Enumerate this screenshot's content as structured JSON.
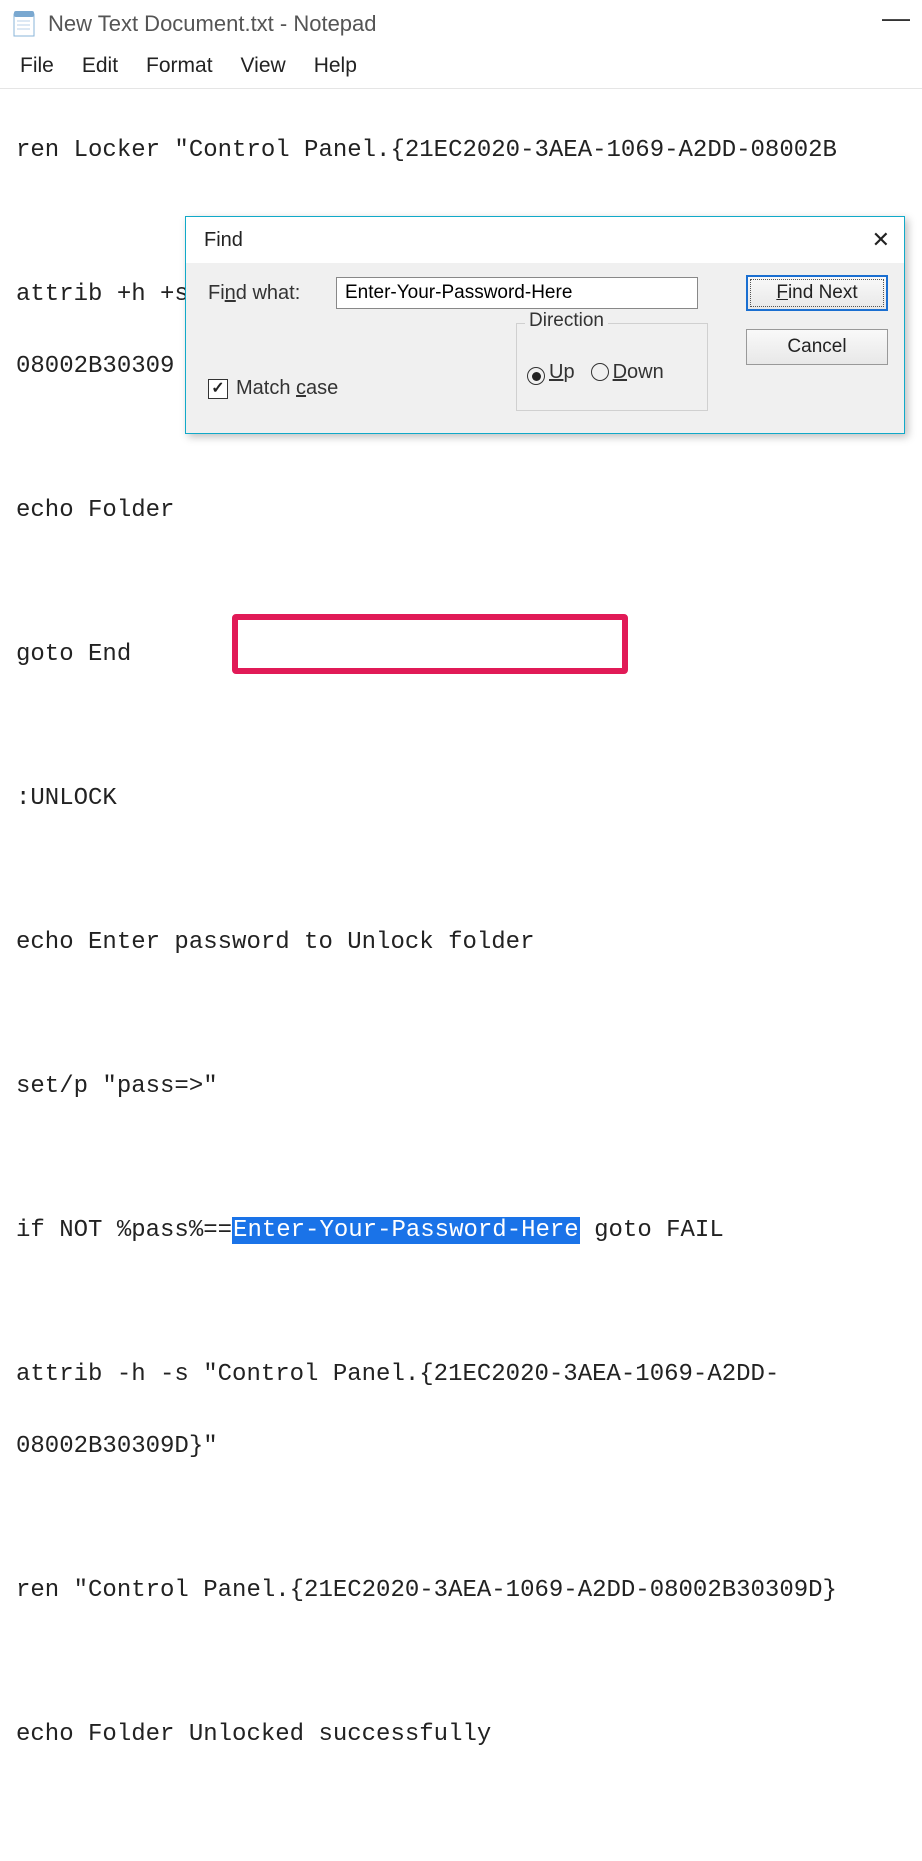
{
  "window": {
    "title": "New Text Document.txt - Notepad"
  },
  "menu": {
    "file": "File",
    "edit": "Edit",
    "format": "Format",
    "view": "View",
    "help": "Help"
  },
  "editor": {
    "l1": "ren Locker \"Control Panel.{21EC2020-3AEA-1069-A2DD-08002B",
    "l2": "attrib +h +s \"Control Panel.{21EC2020-3AEA-1069-A2DD-",
    "l3": "08002B30309",
    "l4": "echo Folder",
    "l5": "goto End",
    "l6": ":UNLOCK",
    "l7": "echo Enter password to Unlock folder",
    "l8": "set/p \"pass=>\"",
    "l9a": "if NOT %pass%==",
    "l9b": "Enter-Your-Password-Here",
    "l9c": " goto FAIL",
    "l10": "attrib -h -s \"Control Panel.{21EC2020-3AEA-1069-A2DD-",
    "l11": "08002B30309D}\"",
    "l12": "ren \"Control Panel.{21EC2020-3AEA-1069-A2DD-08002B30309D}",
    "l13": "echo Folder Unlocked successfully"
  },
  "find": {
    "title": "Find",
    "label_pre": "Fi",
    "label_u": "n",
    "label_post": "d what:",
    "value": "Enter-Your-Password-Here",
    "btn_next_u": "F",
    "btn_next_post": "ind Next",
    "btn_cancel": "Cancel",
    "direction_label": "Direction",
    "up_u": "U",
    "up_post": "p",
    "down_u": "D",
    "down_post": "own",
    "match_pre": "Match ",
    "match_u": "c",
    "match_post": "ase"
  }
}
